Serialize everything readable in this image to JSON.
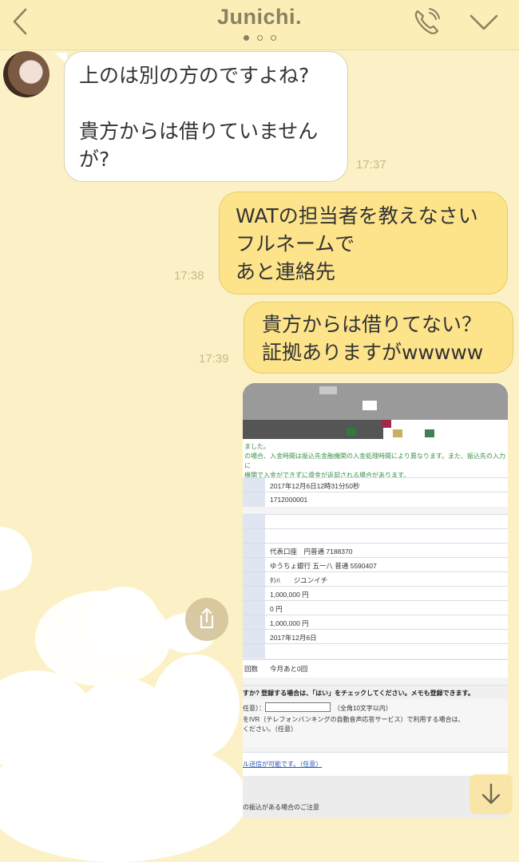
{
  "header": {
    "title": "Junichi.",
    "page_count": 3,
    "active_page": 1
  },
  "icons": {
    "back": "chevron-left-icon",
    "call": "phone-icon",
    "menu": "chevron-down-icon",
    "share": "share-icon",
    "scroll": "arrow-down-icon"
  },
  "messages": [
    {
      "side": "left",
      "text": "上のは別の方のですよね?\n\n貴方からは借りていません\nが?",
      "time": "17:37"
    },
    {
      "side": "right",
      "text": "WATの担当者を教えなさい\nフルネームで\nあと連絡先",
      "time": "17:38"
    },
    {
      "side": "right",
      "text": "貴方からは借りてない？\n証拠ありますがwwwww",
      "time": "17:39"
    }
  ],
  "screenshot_image": {
    "notice_lines": [
      "ました。",
      "の場合、入金時間は振込先金融機関の入金処理時間により異なります。また、振込先の入力に",
      "機関で入金ができずに資金が返却される場合があります。"
    ],
    "rows": [
      "2017年12月6日12時31分50秒",
      "1712000001",
      "",
      "",
      "代表口座　円普通 7188370",
      "ゆうちょ銀行 五一八 普通 5590407",
      "ﾀｼﾊ　　ジユンイチ",
      "1,000,000 円",
      "0 円",
      "1,000,000 円",
      "2017年12月6日",
      ""
    ],
    "count_label": "回数",
    "count_value": "今月あと0回",
    "register_question": "すか? 登録する場合は、「はい」をチェックしてください。メモも登録できます。",
    "memo_label": "任意）：",
    "memo_hint": "（全角10文字以内）",
    "ivr_line1": "をIVR（テレフォンバンキングの自動音声応答サービス）で利用する場合は、",
    "ivr_line2": "ください。（任意）",
    "email_link": "ル送信が可能です。（任意）",
    "footer_note": "の振込がある場合のご注意"
  },
  "colors": {
    "background": "#fcf1c6",
    "header": "#fbeeb6",
    "title_text": "#8a8160",
    "bubble_right": "#fde48a",
    "bubble_left": "#ffffff",
    "time_text": "#c7b98a"
  }
}
